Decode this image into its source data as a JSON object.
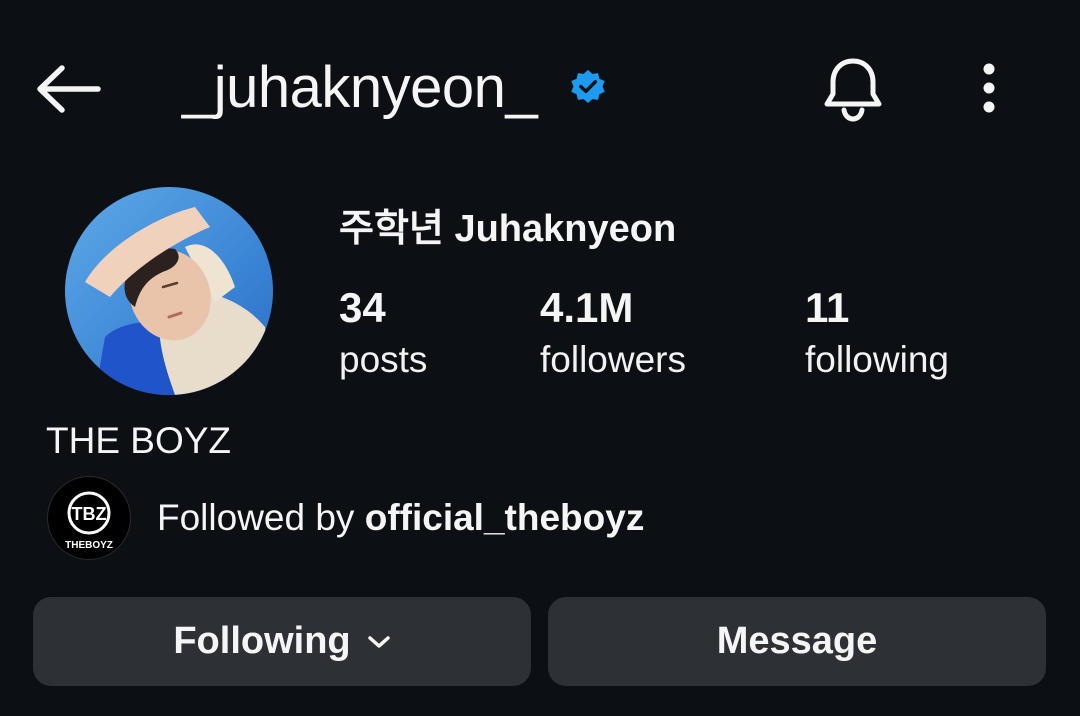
{
  "header": {
    "username": "_juhaknyeon_",
    "back_icon": "arrow-left-icon",
    "verified_icon": "verified-badge-icon",
    "verified_color": "#1d9bf0",
    "bell_icon": "bell-icon",
    "more_icon": "more-vertical-icon"
  },
  "profile": {
    "display_name": "주학년 Juhaknyeon",
    "bio": "THE BOYZ"
  },
  "stats": [
    {
      "value": "34",
      "label": "posts"
    },
    {
      "value": "4.1M",
      "label": "followers"
    },
    {
      "value": "11",
      "label": "following"
    }
  ],
  "mutual": {
    "prefix": "Followed by ",
    "account": "official_theboyz",
    "avatar_logo_text": "TBZ",
    "avatar_caption": "THEBOYZ"
  },
  "actions": {
    "following_label": "Following",
    "message_label": "Message",
    "chevron_icon": "chevron-down-icon"
  },
  "colors": {
    "background": "#0c1014",
    "button_bg": "#2d3136",
    "text": "#f5f5f5"
  }
}
